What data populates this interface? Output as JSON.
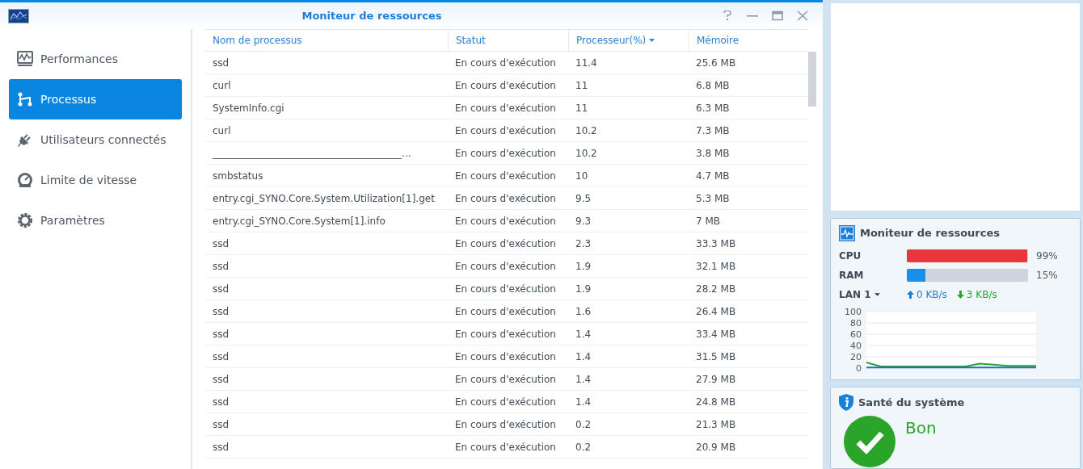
{
  "window": {
    "title": "Moniteur de ressources"
  },
  "sidebar": {
    "items": [
      {
        "label": "Performances",
        "selected": false
      },
      {
        "label": "Processus",
        "selected": true
      },
      {
        "label": "Utilisateurs connectés",
        "selected": false
      },
      {
        "label": "Limite de vitesse",
        "selected": false
      },
      {
        "label": "Paramètres",
        "selected": false
      }
    ]
  },
  "table": {
    "columns": [
      {
        "label": "Nom de processus",
        "sorted": false
      },
      {
        "label": "Statut",
        "sorted": false
      },
      {
        "label": "Processeur(%)",
        "sorted": true
      },
      {
        "label": "Mémoire",
        "sorted": false
      }
    ],
    "rows": [
      [
        "ssd",
        "En cours d'exécution",
        "11.4",
        "25.6 MB"
      ],
      [
        "curl",
        "En cours d'exécution",
        "11",
        "6.8 MB"
      ],
      [
        "SystemInfo.cgi",
        "En cours d'exécution",
        "11",
        "6.3 MB"
      ],
      [
        "curl",
        "En cours d'exécution",
        "10.2",
        "7.3 MB"
      ],
      [
        "_______________________________________…",
        "En cours d'exécution",
        "10.2",
        "3.8 MB"
      ],
      [
        "smbstatus",
        "En cours d'exécution",
        "10",
        "4.7 MB"
      ],
      [
        "entry.cgi_SYNO.Core.System.Utilization[1].get",
        "En cours d'exécution",
        "9.5",
        "5.3 MB"
      ],
      [
        "entry.cgi_SYNO.Core.System[1].info",
        "En cours d'exécution",
        "9.3",
        "7 MB"
      ],
      [
        "ssd",
        "En cours d'exécution",
        "2.3",
        "33.3 MB"
      ],
      [
        "ssd",
        "En cours d'exécution",
        "1.9",
        "32.1 MB"
      ],
      [
        "ssd",
        "En cours d'exécution",
        "1.9",
        "28.2 MB"
      ],
      [
        "ssd",
        "En cours d'exécution",
        "1.6",
        "26.4 MB"
      ],
      [
        "ssd",
        "En cours d'exécution",
        "1.4",
        "33.4 MB"
      ],
      [
        "ssd",
        "En cours d'exécution",
        "1.4",
        "31.5 MB"
      ],
      [
        "ssd",
        "En cours d'exécution",
        "1.4",
        "27.9 MB"
      ],
      [
        "ssd",
        "En cours d'exécution",
        "1.4",
        "24.8 MB"
      ],
      [
        "ssd",
        "En cours d'exécution",
        "0.2",
        "21.3 MB"
      ],
      [
        "ssd",
        "En cours d'exécution",
        "0.2",
        "20.9 MB"
      ]
    ]
  },
  "resource_widget": {
    "title": "Moniteur de ressources",
    "meters": [
      {
        "label": "CPU",
        "level": 0.99,
        "reading": "99%",
        "color": "#e8363c"
      },
      {
        "label": "RAM",
        "level": 0.15,
        "reading": "15%",
        "color": "#1a8fe8"
      }
    ],
    "network": {
      "interface": "LAN 1",
      "upload": "0 KB/s",
      "download": "3 KB/s"
    },
    "chart_data": {
      "type": "line",
      "grid": true,
      "ylim": [
        0,
        100
      ],
      "yticks": [
        0,
        20,
        40,
        60,
        80,
        100
      ],
      "series": [
        {
          "color": "#2aa52a",
          "values": [
            10,
            3,
            3,
            3,
            3,
            3,
            3,
            3,
            8,
            6,
            4,
            4,
            4
          ]
        },
        {
          "color": "#1a6fd0",
          "values": [
            1,
            1,
            1,
            1,
            1,
            1,
            1,
            1,
            1,
            1,
            1,
            1,
            1
          ]
        }
      ]
    }
  },
  "health_widget": {
    "title": "Santé du système",
    "status": "Bon",
    "healthy": true
  }
}
